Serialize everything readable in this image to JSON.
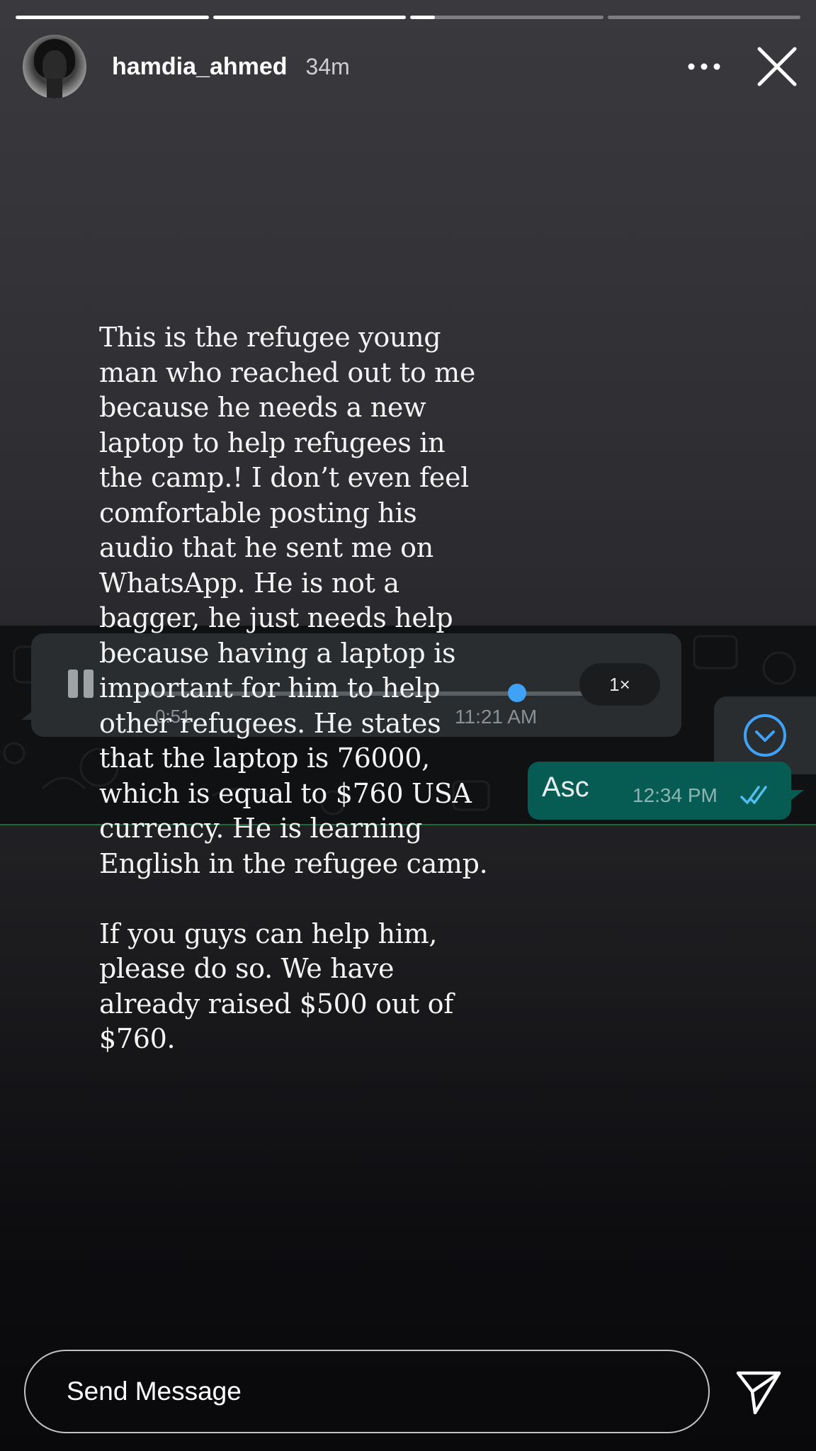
{
  "story": {
    "progress": [
      1.0,
      1.0,
      0.13,
      0.0
    ]
  },
  "header": {
    "username": "hamdia_ahmed",
    "time_ago": "34m",
    "more_icon": "more-horizontal-icon",
    "close_icon": "close-icon"
  },
  "screenshot": {
    "voice_note": {
      "duration": "0:51",
      "time": "11:21 AM",
      "speed": "1×",
      "playback_progress": 0.85
    },
    "sent_message": {
      "text": "Asc",
      "time": "12:34 PM"
    },
    "accent_color": "#3fa2f7",
    "sent_bubble_color": "#065c53"
  },
  "caption": {
    "text": "This is the refugee young\nman who reached out to me\nbecause he needs a new\nlaptop to help refugees in\nthe camp.! I don’t even feel\ncomfortable posting his\naudio that he sent me on\nWhatsApp. He is not a\nbagger, he just needs help\nbecause having a laptop is\nimportant for him to help\nother refugees. He states\nthat the laptop is 76000,\nwhich is equal to $760 USA\ncurrency.  He is learning\nEnglish in the refugee camp.\n\nIf you guys can help him,\nplease do so.  We have\nalready raised $500 out of\n$760."
  },
  "footer": {
    "input_placeholder": "Send Message",
    "send_icon": "send-icon"
  }
}
